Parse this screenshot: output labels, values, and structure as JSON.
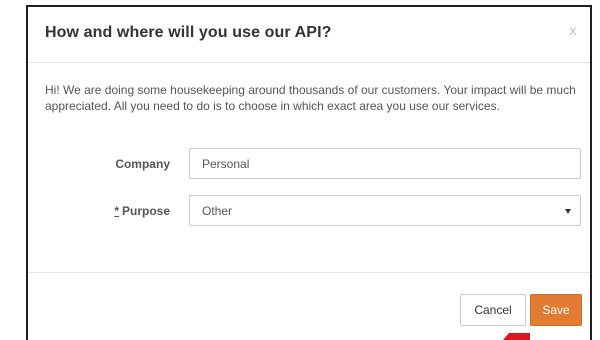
{
  "dialog": {
    "title": "How and where will you use our API?",
    "close_label": "x",
    "intro": "Hi! We are doing some housekeeping around thousands of our customers. Your impact will be much appreciated. All you need to do is to choose in which exact area you use our services."
  },
  "form": {
    "company": {
      "label": "Company",
      "value": "Personal"
    },
    "purpose": {
      "required_mark": "*",
      "label": "Purpose",
      "selected": "Other"
    }
  },
  "footer": {
    "cancel_label": "Cancel",
    "save_label": "Save"
  },
  "colors": {
    "accent": "#e07b31",
    "pointer": "#e0141e"
  },
  "icons": {
    "close": "close-icon",
    "dropdown": "caret-down-icon",
    "pointer": "red-arrow-icon"
  }
}
